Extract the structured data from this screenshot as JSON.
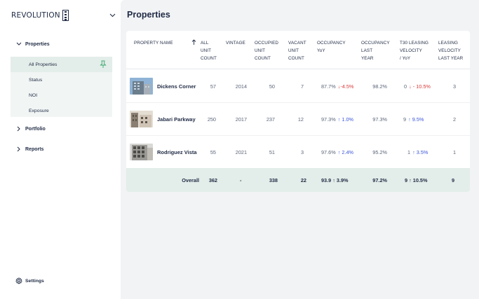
{
  "brand": {
    "name": "REVOLUTION"
  },
  "sidebar": {
    "groups": [
      {
        "label": "Properties",
        "expanded": true
      },
      {
        "label": "Portfolio",
        "expanded": false
      },
      {
        "label": "Reports",
        "expanded": false
      }
    ],
    "subitems": [
      {
        "label": "All Properties",
        "active": true
      },
      {
        "label": "Status"
      },
      {
        "label": "NOI"
      },
      {
        "label": "Exposure"
      }
    ],
    "settings_label": "Settings"
  },
  "page": {
    "title": "Properties"
  },
  "table": {
    "headers": {
      "name": "PROPERTY NAME",
      "unit_count": [
        "ALL",
        "UNIT",
        "COUNT"
      ],
      "vintage": [
        "VINTAGE"
      ],
      "occupied": [
        "OCCUPIED",
        "UNIT",
        "COUNT"
      ],
      "vacant": [
        "VACANT",
        "UNIT",
        "COUNT"
      ],
      "occupancy": [
        "OCCUPANCY",
        "YoY"
      ],
      "occupancy_last": [
        "OCCUPANCY",
        "LAST",
        "YEAR"
      ],
      "t30": [
        "T30 LEASING",
        "VELOCITY",
        "/ YoY"
      ],
      "leasing_last": [
        "LEASING",
        "VELOCITY",
        "LAST YEAR"
      ]
    },
    "rows": [
      {
        "name": "Dickens Corner",
        "units": "57",
        "vintage": "2014",
        "occupied": "50",
        "vacant": "7",
        "occupancy": "87.7%",
        "occ_change": "↓-4.5%",
        "occ_dir": "down",
        "occ_last": "98.2%",
        "t30": "0",
        "t30_change": "↓ - 10.5%",
        "t30_dir": "down",
        "leasing_last": "3"
      },
      {
        "name": "Jabari Parkway",
        "units": "250",
        "vintage": "2017",
        "occupied": "237",
        "vacant": "12",
        "occupancy": "97.3%",
        "occ_change": "↑ 1.0%",
        "occ_dir": "up",
        "occ_last": "97.3%",
        "t30": "9",
        "t30_change": "↑ 9.5%",
        "t30_dir": "up",
        "leasing_last": "2"
      },
      {
        "name": "Rodriguez Vista",
        "units": "55",
        "vintage": "2021",
        "occupied": "51",
        "vacant": "3",
        "occupancy": "97.6%",
        "occ_change": "↑ 2.4%",
        "occ_dir": "up",
        "occ_last": "95.2%",
        "t30": "1",
        "t30_change": "↑ 3.5%",
        "t30_dir": "up",
        "leasing_last": "1"
      }
    ],
    "total": {
      "label": "Overall",
      "units": "362",
      "vintage": "-",
      "occupied": "338",
      "vacant": "22",
      "occupancy": "93.9 ↑ 3.9%",
      "occ_last": "97.2%",
      "t30": "9 ↑ 10.5%",
      "leasing_last": "9"
    }
  },
  "colors": {
    "accent_bg": "#e3ede9",
    "down": "#d93a3a",
    "up": "#3a56d9",
    "text": "#1f2a44"
  }
}
